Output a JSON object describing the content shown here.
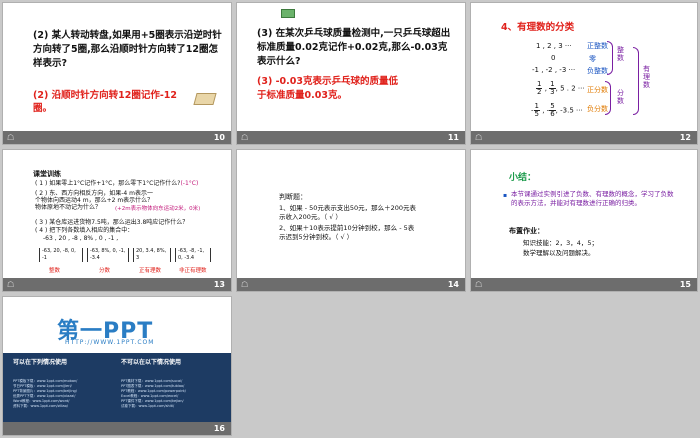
{
  "slides": [
    {
      "number": "10",
      "question": "(2) 某人转动转盘,如果用+5圈表示沿逆时针方向转了5圈,那么沿顺时针方向转了12圈怎样表示?",
      "answer": "(2) 沿顺时针方向转12圈记作-12圈。"
    },
    {
      "number": "11",
      "question": "(3) 在某次乒乓球质量检测中,一只乒乓球超出标准质量0.02克记作+0.02克,那么-0.03克表示什么?",
      "answer": "(3) -0.03克表示乒乓球的质量低于标准质量0.03克。"
    },
    {
      "number": "12",
      "title": "4、有理数的分类",
      "row1": "1 , 2 , 3 ···",
      "row2": "0",
      "row3": "-1 , -2 , -3 ···",
      "lbl_pos_int": "正整数",
      "lbl_zero": "零",
      "lbl_neg_int": "负整数",
      "lbl_pos_frac": "正分数",
      "lbl_neg_frac": "负分数",
      "grp_int": "整数",
      "grp_frac": "分数",
      "grp_rational": "有理数",
      "f1n": "1",
      "f1d": "2",
      "f2n": "1",
      "f2d": "3",
      "f3tail": ", 5 . 2 ···",
      "f4n": "1",
      "f4d": "5",
      "f5n": "5",
      "f5d": "6",
      "f6tail": ", -3.5 ···"
    },
    {
      "number": "13",
      "title": "课堂训练",
      "q1": "( 1 ) 如果零上1°C记作+1°C，那么零下1°C记作什么?",
      "a1": "(-1°C)",
      "q2": "( 2 ) 东、西方向相反方向，如果-4 m表示一个物体向西运动4 m，那么+2 m表示什么？物体原地不动记为什么？",
      "a2": "(+2m表示物体向东运动2米，0米)",
      "q3": "( 3 ) 某仓库运进货物7.5吨，那么运出3.8吨应记作什么？",
      "q4": "( 4 ) 把下列各数填入相应的集合中：",
      "nums": "-63 , 20 , -8 , 8% , 0 , -1 ,",
      "set1": "-63, 20, -8, 0, -1",
      "set2": "-63, 8%, 0, -1, -3.4",
      "set3": "20, 3.4, 8%, 3",
      "set4": "-63, -8, -1, 0, -3.4",
      "cap1": "整数",
      "cap2": "分数",
      "cap3": "正有理数",
      "cap4": "非正有理数"
    },
    {
      "number": "14",
      "title": "判断题：",
      "l1": "1、如果 - 50元表示支出50元，那么＋200元表示收入200元。（ √ ）",
      "l2": "2、如果＋10表示提前10分钟到校，那么 - 5表示迟到5分钟到校。（ √ ）"
    },
    {
      "number": "15",
      "title": "小结：",
      "summary": "本节课通过实例引进了负数、有理数的概念，学习了负数的表示方法，并能对有理数进行正确的归类。",
      "hw_title": "布置作业：",
      "hw1": "知识技能：2，3，4，5；",
      "hw2": "数学理解以及问题解决。"
    },
    {
      "number": "16",
      "brand": "第一PPT",
      "url": "HTTP://WWW.1PPT.COM",
      "col1_title": "可以在下列情况使用",
      "col2_title": "不可以在以下情况使用",
      "links": [
        "PPT模板下载：www.1ppt.com/moban/",
        "节日PPT模板：www.1ppt.com/jieri/",
        "PPT背景图片：www.1ppt.com/beijing/",
        "优秀PPT下载：www.1ppt.com/xiazai/",
        "Word教程：www.1ppt.com/word/",
        "资料下载：www.1ppt.com/ziliao/",
        "PPT素材下载：www.1ppt.com/sucai/",
        "PPT图表下载：www.1ppt.com/tubiao/",
        "PPT教程：www.1ppt.com/powerpoint/",
        "Excel教程：www.1ppt.com/excel/",
        "PPT课件下载：www.1ppt.com/kejian/",
        "试卷下载：www.1ppt.com/shiti/"
      ]
    }
  ]
}
